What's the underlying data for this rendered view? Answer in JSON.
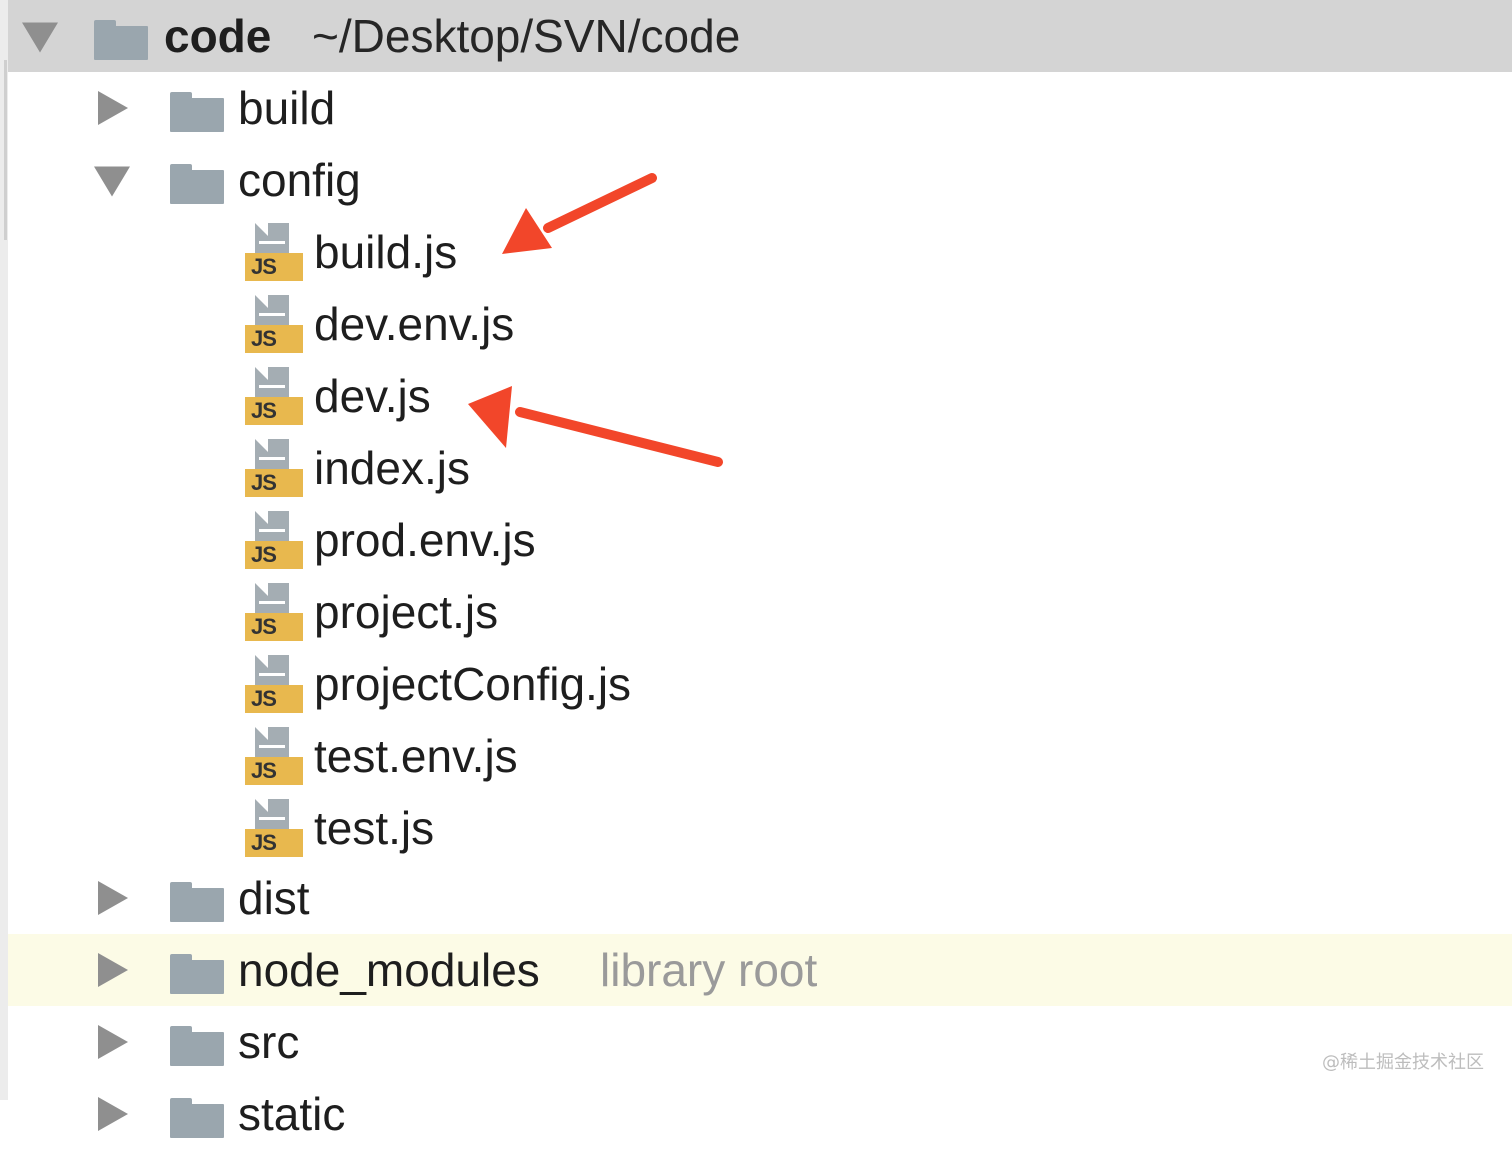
{
  "root": {
    "name": "code",
    "path": "~/Desktop/SVN/code"
  },
  "folders": {
    "build": "build",
    "config": "config",
    "dist": "dist",
    "node_modules": "node_modules",
    "node_modules_note": "library root",
    "src": "src",
    "static": "static"
  },
  "config_files": [
    "build.js",
    "dev.env.js",
    "dev.js",
    "index.js",
    "prod.env.js",
    "project.js",
    "projectConfig.js",
    "test.env.js",
    "test.js"
  ],
  "js_badge": "JS",
  "watermark": "@稀土掘金技术社区",
  "colors": {
    "annotation_arrow": "#f2462a",
    "highlight_row": "#fcfbe6",
    "root_row": "#d4d4d4",
    "js_badge": "#e8b84e",
    "folder": "#9aa6ae"
  }
}
